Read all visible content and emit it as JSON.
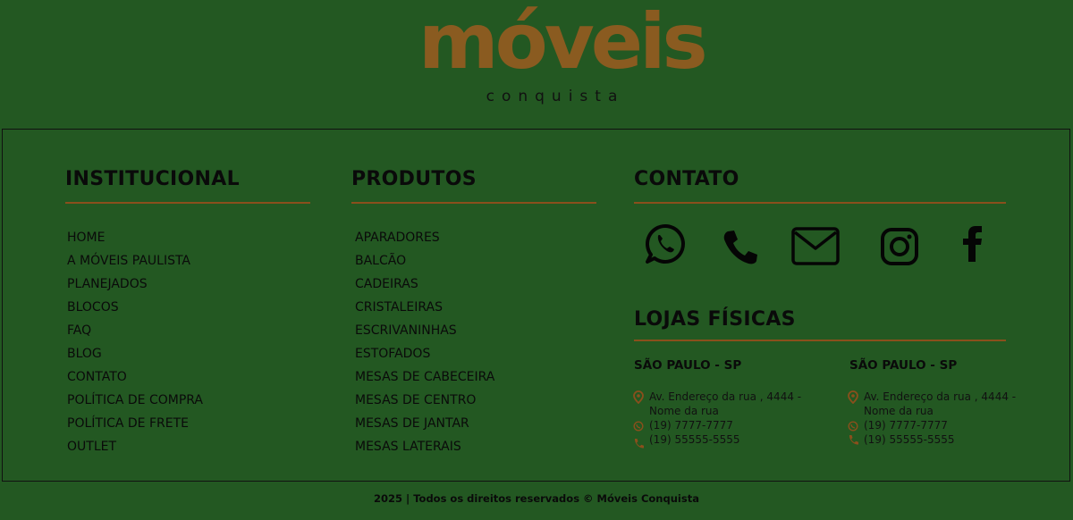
{
  "logo": {
    "main": "móveis",
    "sub": "conquista"
  },
  "institucional": {
    "title": "INSTITUCIONAL",
    "links": [
      "HOME",
      "A MÓVEIS PAULISTA",
      "PLANEJADOS",
      "BLOCOS",
      "FAQ",
      "BLOG",
      "CONTATO",
      "POLÍTICA DE COMPRA",
      "POLÍTICA DE FRETE",
      "OUTLET"
    ]
  },
  "produtos": {
    "title": "PRODUTOS",
    "links": [
      "APARADORES",
      "BALCÃO",
      "CADEIRAS",
      "CRISTALEIRAS",
      "ESCRIVANINHAS",
      "ESTOFADOS",
      "MESAS DE CABECEIRA",
      "MESAS DE CENTRO",
      "MESAS DE JANTAR",
      "MESAS LATERAIS"
    ]
  },
  "contato": {
    "title": "CONTATO",
    "icons": [
      "whatsapp-icon",
      "phone-icon",
      "mail-icon",
      "instagram-icon",
      "facebook-icon"
    ]
  },
  "lojas": {
    "title": "LOJAS FÍSICAS",
    "stores": [
      {
        "name": "SÃO PAULO - SP",
        "address": "Av. Endereço da rua , 4444 - Nome da rua",
        "whatsapp": "(19) 7777-7777",
        "phone": "(19) 55555-5555"
      },
      {
        "name": "SÃO PAULO - SP",
        "address": "Av. Endereço da rua , 4444 - Nome da rua",
        "whatsapp": "(19) 7777-7777",
        "phone": "(19) 55555-5555"
      }
    ]
  },
  "colors": {
    "background": "#235822",
    "brand": "#8a5b20",
    "rule": "#8a4f1c"
  },
  "copyright": "2025 | Todos os direitos reservados © Móveis Conquista"
}
